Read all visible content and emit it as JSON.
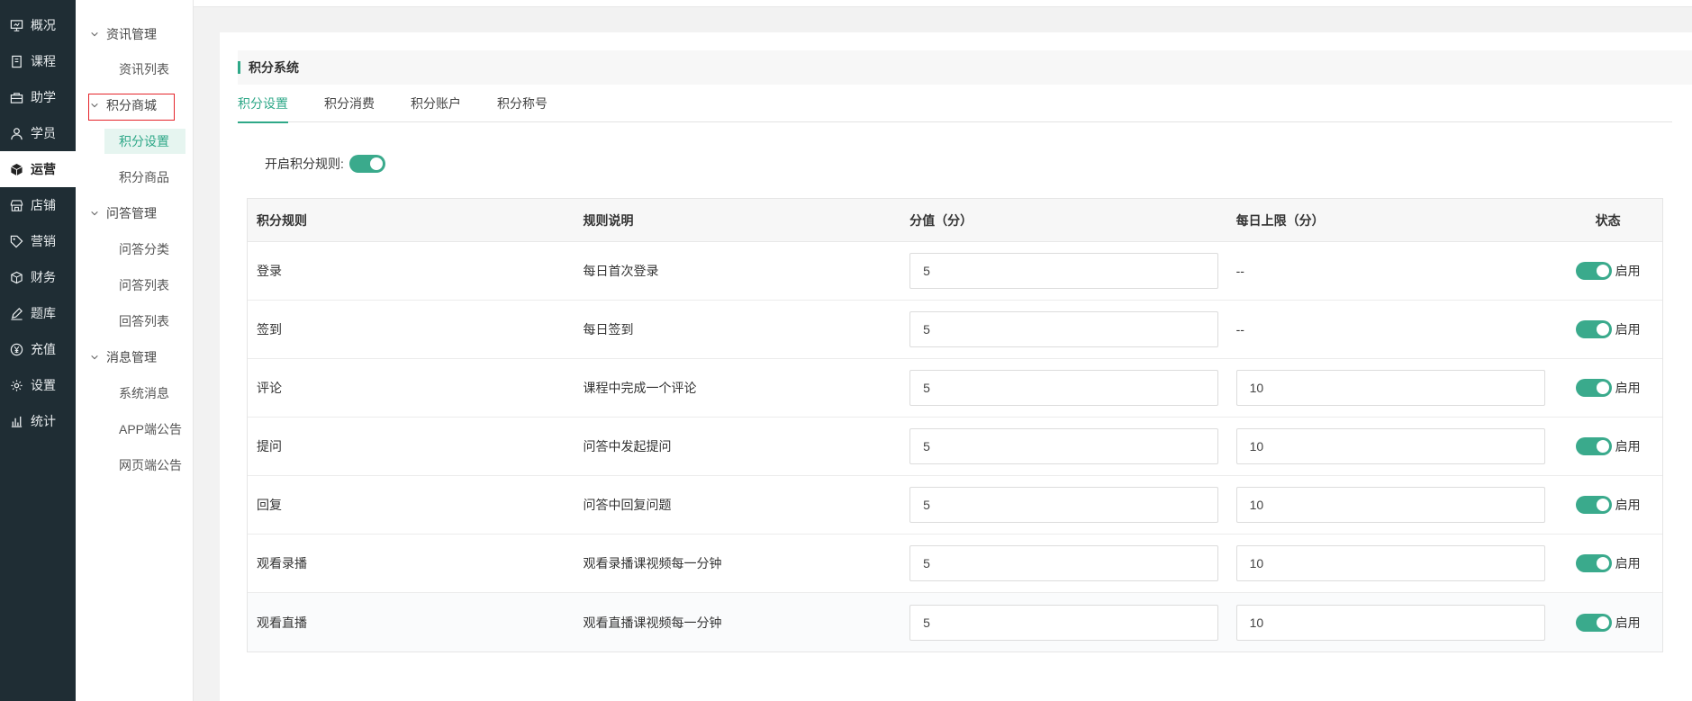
{
  "rail": [
    {
      "label": "概况",
      "icon": "overview-icon"
    },
    {
      "label": "课程",
      "icon": "course-icon"
    },
    {
      "label": "助学",
      "icon": "study-icon"
    },
    {
      "label": "学员",
      "icon": "user-icon"
    },
    {
      "label": "运营",
      "icon": "operation-icon"
    },
    {
      "label": "店铺",
      "icon": "store-icon"
    },
    {
      "label": "营销",
      "icon": "tag-icon"
    },
    {
      "label": "财务",
      "icon": "finance-icon"
    },
    {
      "label": "题库",
      "icon": "pen-icon"
    },
    {
      "label": "充值",
      "icon": "yuan-icon"
    },
    {
      "label": "设置",
      "icon": "gear-icon"
    },
    {
      "label": "统计",
      "icon": "stats-icon"
    }
  ],
  "subnav": {
    "groups": [
      {
        "label": "资讯管理"
      },
      {
        "label": "积分商城"
      },
      {
        "label": "问答管理"
      },
      {
        "label": "消息管理"
      }
    ],
    "items": [
      {
        "label": "资讯列表"
      },
      {
        "label": "积分设置"
      },
      {
        "label": "积分商品"
      },
      {
        "label": "问答分类"
      },
      {
        "label": "问答列表"
      },
      {
        "label": "回答列表"
      },
      {
        "label": "系统消息"
      },
      {
        "label": "APP端公告"
      },
      {
        "label": "网页端公告"
      }
    ]
  },
  "panel": {
    "title": "积分系统",
    "tabs": [
      "积分设置",
      "积分消费",
      "积分账户",
      "积分称号"
    ],
    "enable_label": "开启积分规则:",
    "enable_on": true
  },
  "table": {
    "headers": [
      "积分规则",
      "规则说明",
      "分值（分）",
      "每日上限（分）",
      "状态"
    ],
    "rows": [
      {
        "rule": "登录",
        "desc": "每日首次登录",
        "score": "5",
        "limit": "--",
        "limit_input": false,
        "status": "启用"
      },
      {
        "rule": "签到",
        "desc": "每日签到",
        "score": "5",
        "limit": "--",
        "limit_input": false,
        "status": "启用"
      },
      {
        "rule": "评论",
        "desc": "课程中完成一个评论",
        "score": "5",
        "limit": "10",
        "limit_input": true,
        "status": "启用"
      },
      {
        "rule": "提问",
        "desc": "问答中发起提问",
        "score": "5",
        "limit": "10",
        "limit_input": true,
        "status": "启用"
      },
      {
        "rule": "回复",
        "desc": "问答中回复问题",
        "score": "5",
        "limit": "10",
        "limit_input": true,
        "status": "启用"
      },
      {
        "rule": "观看录播",
        "desc": "观看录播课视频每一分钟",
        "score": "5",
        "limit": "10",
        "limit_input": true,
        "status": "启用"
      },
      {
        "rule": "观看直播",
        "desc": "观看直播课视频每一分钟",
        "score": "5",
        "limit": "10",
        "limit_input": true,
        "status": "启用"
      }
    ]
  },
  "colors": {
    "accent": "#3aaa8c",
    "rail_bg": "#1f2d34",
    "highlight_border": "#e5242b"
  }
}
